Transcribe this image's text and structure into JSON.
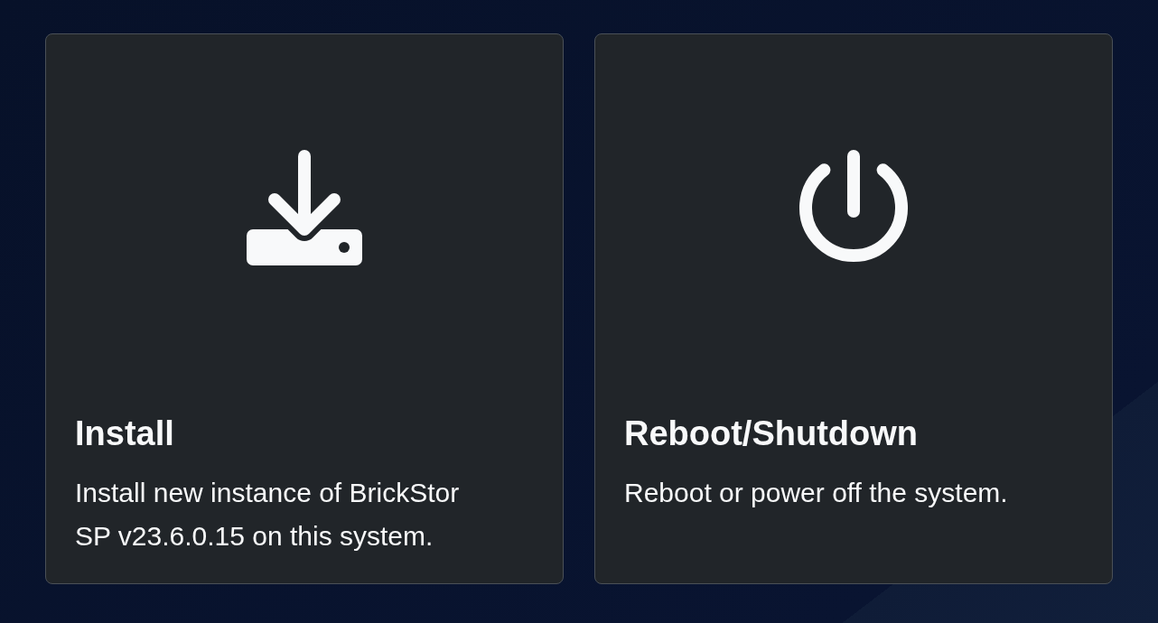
{
  "cards": [
    {
      "kind": "install",
      "title": "Install",
      "description": "Install new instance of BrickStor SP v23.6.0.15 on this system."
    },
    {
      "kind": "power",
      "title": "Reboot/Shutdown",
      "description": "Reboot or power off the system."
    }
  ]
}
